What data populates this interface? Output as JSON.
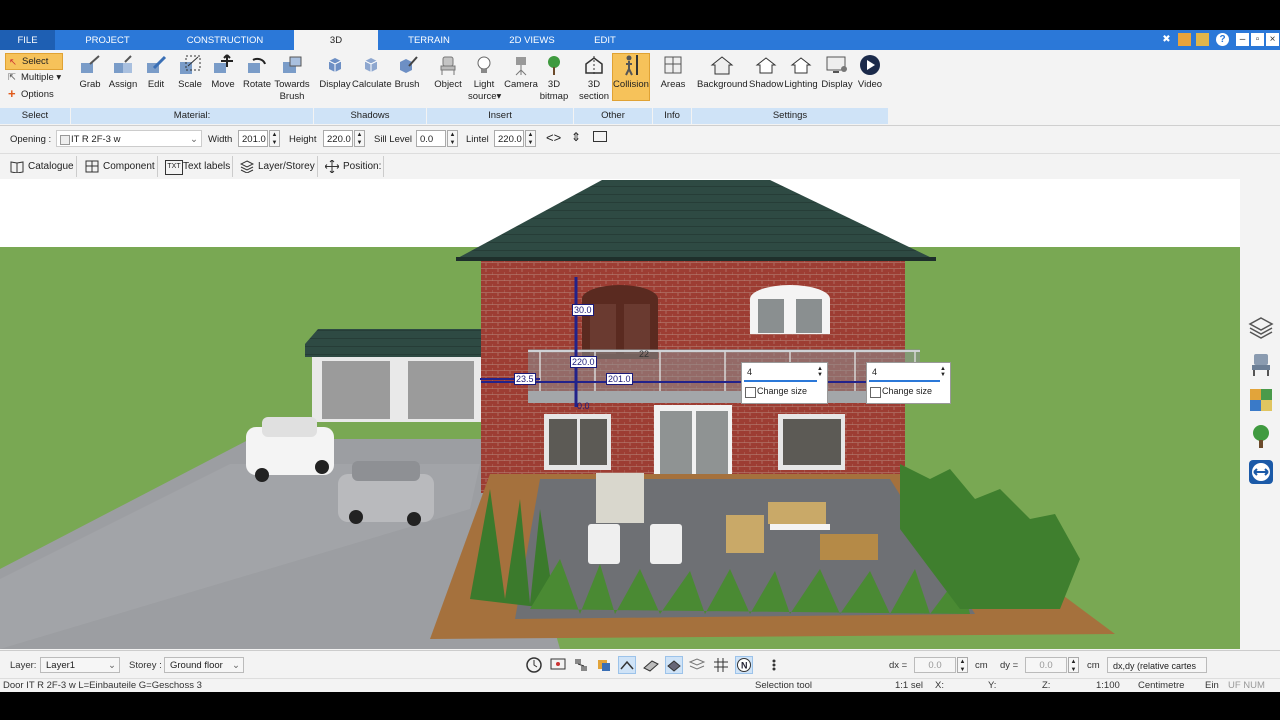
{
  "tabs": [
    "FILE",
    "PROJECT",
    "CONSTRUCTION",
    "3D",
    "TERRAIN",
    "2D VIEWS",
    "EDIT"
  ],
  "select_group": {
    "select": "Select",
    "multiple": "Multiple",
    "options": "Options",
    "label": "Select"
  },
  "ribbon": {
    "material": [
      "Grab",
      "Assign",
      "Edit",
      "Scale",
      "Move",
      "Rotate"
    ],
    "towards_brush": [
      "Towards",
      "Brush"
    ],
    "shadows": [
      "Display",
      "Calculate",
      "Brush"
    ],
    "insert": {
      "object": "Object",
      "light": [
        "Light",
        "source"
      ],
      "camera": "Camera",
      "bitmap": [
        "3D",
        "bitmap"
      ]
    },
    "other": {
      "section": [
        "3D",
        "section"
      ],
      "collision": "Collision"
    },
    "info": {
      "areas": "Areas"
    },
    "settings": [
      "Background",
      "Shadow",
      "Lighting",
      "Display",
      "Video"
    ],
    "groups": {
      "select": "Select",
      "material": "Material:",
      "shadows": "Shadows",
      "insert": "Insert",
      "other": "Other",
      "info": "Info",
      "settings": "Settings"
    }
  },
  "props": {
    "opening_label": "Opening :",
    "opening_value": "IT R 2F-3 w",
    "width_label": "Width",
    "width": "201.0",
    "height_label": "Height",
    "height": "220.0",
    "sill_label": "Sill Level",
    "sill": "0.0",
    "lintel_label": "Lintel",
    "lintel": "220.0"
  },
  "toolbar2": [
    "Catalogue",
    "Component",
    "Text labels",
    "Layer/Storey",
    "Position:"
  ],
  "viewport": {
    "dim_labels": {
      "top": "30.0",
      "height": "220.0",
      "left": "23.5",
      "width": "201.0",
      "bottom": "0.0",
      "window": "22"
    },
    "input1": {
      "value": "4",
      "check": "Change size"
    },
    "input2": {
      "value": "4",
      "check": "Change size"
    }
  },
  "layer_bar": {
    "layer_label": "Layer:",
    "layer_value": "Layer1",
    "storey_label": "Storey :",
    "storey_value": "Ground floor",
    "dx_label": "dx =",
    "dx": "0.0",
    "dy_label": "dy =",
    "dy": "0.0",
    "unit": "cm",
    "coord_mode": "dx,dy (relative cartes"
  },
  "status": {
    "left": "Door IT R 2F-3 w L=Einbauteile G=Geschoss 3",
    "tool": "Selection tool",
    "scale_sel": "1:1 sel",
    "x": "X:",
    "y": "Y:",
    "z": "Z:",
    "scale": "1:100",
    "units": "Centimetre",
    "ein": "Ein",
    "uf": "UF NUM RF"
  },
  "colors": {
    "tab_blue": "#2b78d8",
    "group_blue": "#cfe3f7",
    "active_orange": "#f6c25a"
  }
}
